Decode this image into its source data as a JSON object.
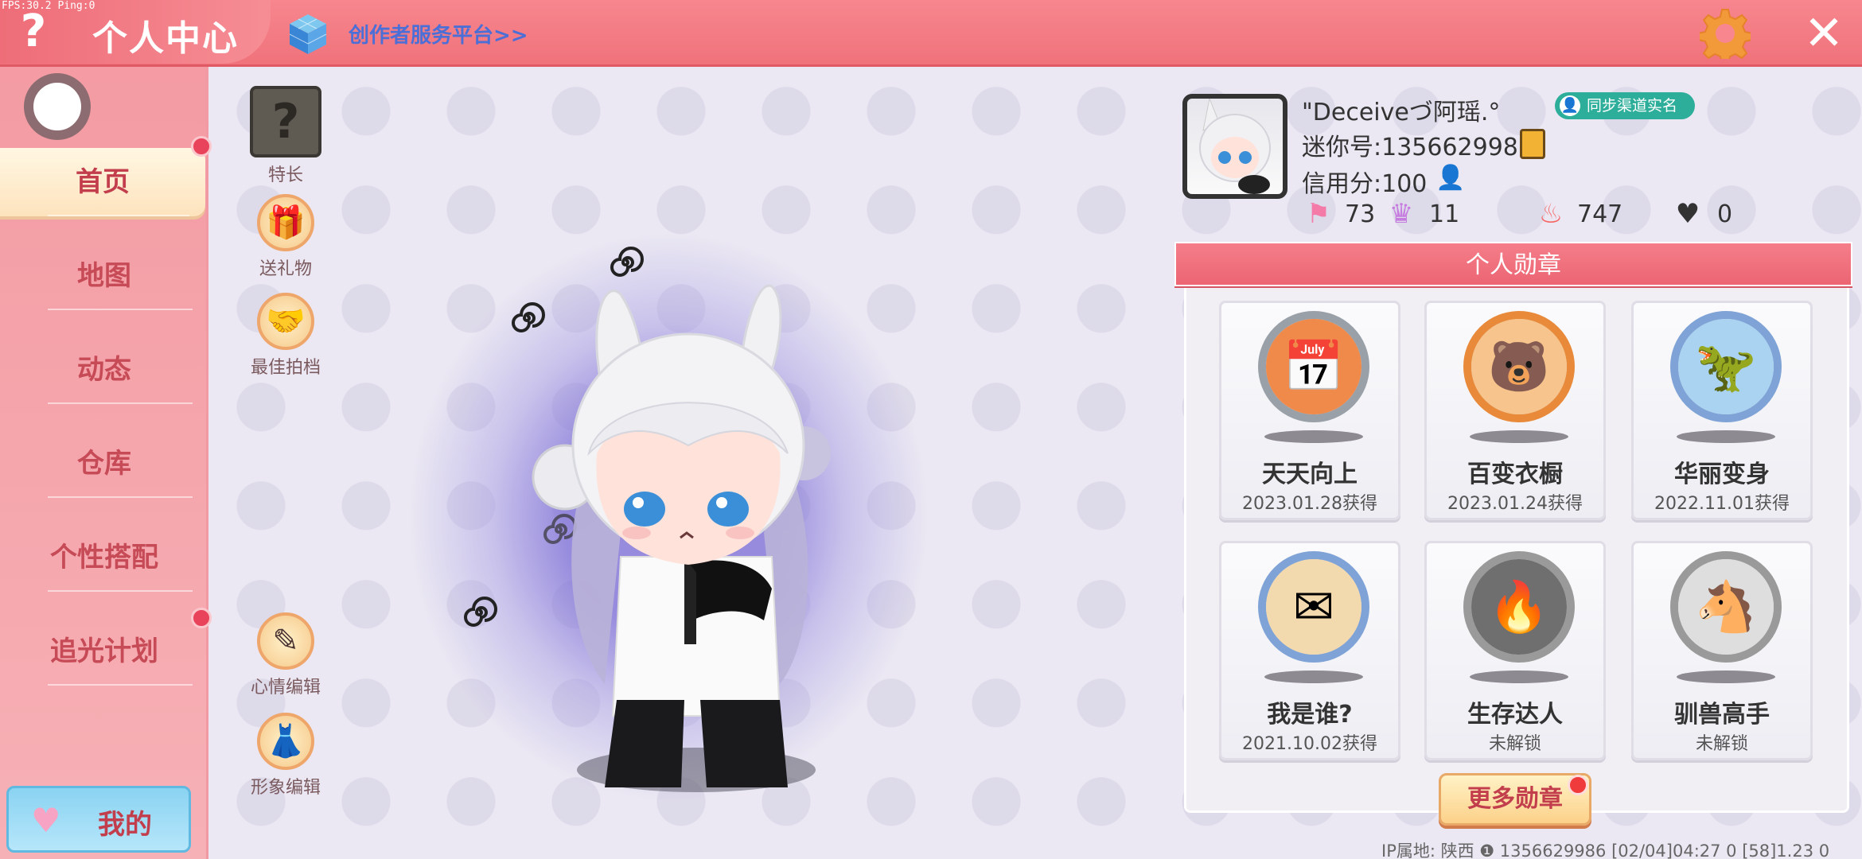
{
  "debug": {
    "fps": "FPS:30.2  Ping:0"
  },
  "header": {
    "title": "个人中心",
    "creator_link": "创作者服务平台>>",
    "help": "?",
    "close": "✕"
  },
  "sidebar": {
    "items": [
      {
        "label": "首页",
        "active": true,
        "dot": true
      },
      {
        "label": "地图"
      },
      {
        "label": "动态"
      },
      {
        "label": "仓库"
      },
      {
        "label": "个性搭配"
      },
      {
        "label": "追光计划",
        "dot": true
      }
    ],
    "mine_label": "我的"
  },
  "actions": {
    "specialty": "特长",
    "gift": "送礼物",
    "partner": "最佳拍档",
    "mood": "心情编辑",
    "image": "形象编辑"
  },
  "profile": {
    "name": "\"Deceiveづ阿瑶.°",
    "sync_label": "同步渠道实名",
    "mini_id": "迷你号:1356629986",
    "credit": "信用分:100",
    "stats": {
      "flag": "73",
      "trophy": "11",
      "fire": "747",
      "likes": "0"
    }
  },
  "badges": {
    "title": "个人勋章",
    "items": [
      {
        "name": "天天向上",
        "date": "2023.01.28获得",
        "icon": "calendar-icon",
        "ring": "#9aa0a8",
        "bg": "#f08a4b"
      },
      {
        "name": "百变衣橱",
        "date": "2023.01.24获得",
        "icon": "bear-icon",
        "ring": "#e88a3a",
        "bg": "#f6c48c"
      },
      {
        "name": "华丽变身",
        "date": "2022.11.01获得",
        "icon": "dino-icon",
        "ring": "#7fa3d6",
        "bg": "#a9d3f0"
      },
      {
        "name": "我是谁?",
        "date": "2021.10.02获得",
        "icon": "card-icon",
        "ring": "#7fa3d6",
        "bg": "#f3d9ae"
      },
      {
        "name": "生存达人",
        "date": "未解锁",
        "icon": "campfire-icon",
        "ring": "#9a9a9a",
        "bg": "#6f6f6f"
      },
      {
        "name": "驯兽高手",
        "date": "未解锁",
        "icon": "horse-icon",
        "ring": "#9a9a9a",
        "bg": "#dedede"
      }
    ],
    "more": "更多勋章"
  },
  "footer": {
    "text": "IP属地: 陕西 ❶   1356629986   [02/04]04:27 0   [58]1.23 0"
  }
}
